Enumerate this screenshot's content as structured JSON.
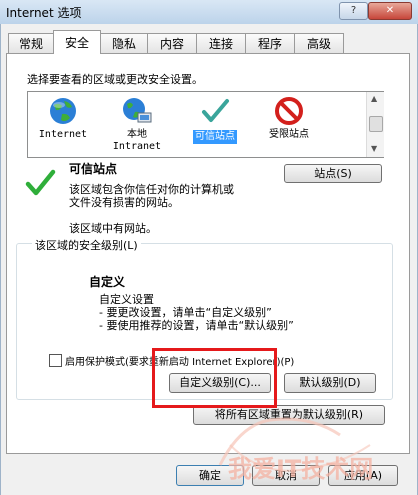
{
  "window": {
    "title": "Internet 选项",
    "help_label": "?",
    "close_label": "✕"
  },
  "tabs": [
    {
      "label": "常规"
    },
    {
      "label": "安全"
    },
    {
      "label": "隐私"
    },
    {
      "label": "内容"
    },
    {
      "label": "连接"
    },
    {
      "label": "程序"
    },
    {
      "label": "高级"
    }
  ],
  "active_tab": "安全",
  "security": {
    "instruction": "选择要查看的区域或更改安全设置。",
    "zones": [
      {
        "label": "Internet",
        "icon": "globe-icon"
      },
      {
        "label": "本地\nIntranet",
        "icon": "intranet-globe-icon"
      },
      {
        "label": "可信站点",
        "icon": "checkmark-icon",
        "selected": true
      },
      {
        "label": "受限站点",
        "icon": "no-entry-icon"
      }
    ],
    "selected_zone": {
      "name": "可信站点",
      "description_line1": "该区域包含你信任对你的计算机或",
      "description_line2": "文件没有损害的网站。",
      "no_sites": "该区域中有网站。",
      "sites_button": "站点(S)"
    },
    "level_group_title": "该区域的安全级别(L)",
    "level": {
      "name": "自定义",
      "line1": "自定义设置",
      "line2": "- 要更改设置，请单击“自定义级别”",
      "line3": "- 要使用推荐的设置，请单击“默认级别”"
    },
    "protected_mode_label": "启用保护模式(要求重新启动 Internet Explorer)(P)",
    "protected_mode_checked": false,
    "custom_level_button": "自定义级别(C)...",
    "default_level_button": "默认级别(D)",
    "reset_all_button": "将所有区域重置为默认级别(R)"
  },
  "footer": {
    "ok": "确定",
    "cancel": "取消",
    "apply": "应用(A)"
  },
  "watermark": "我爱IT技术网",
  "colors": {
    "highlight": "#e5191b",
    "selection": "#3399ff"
  }
}
